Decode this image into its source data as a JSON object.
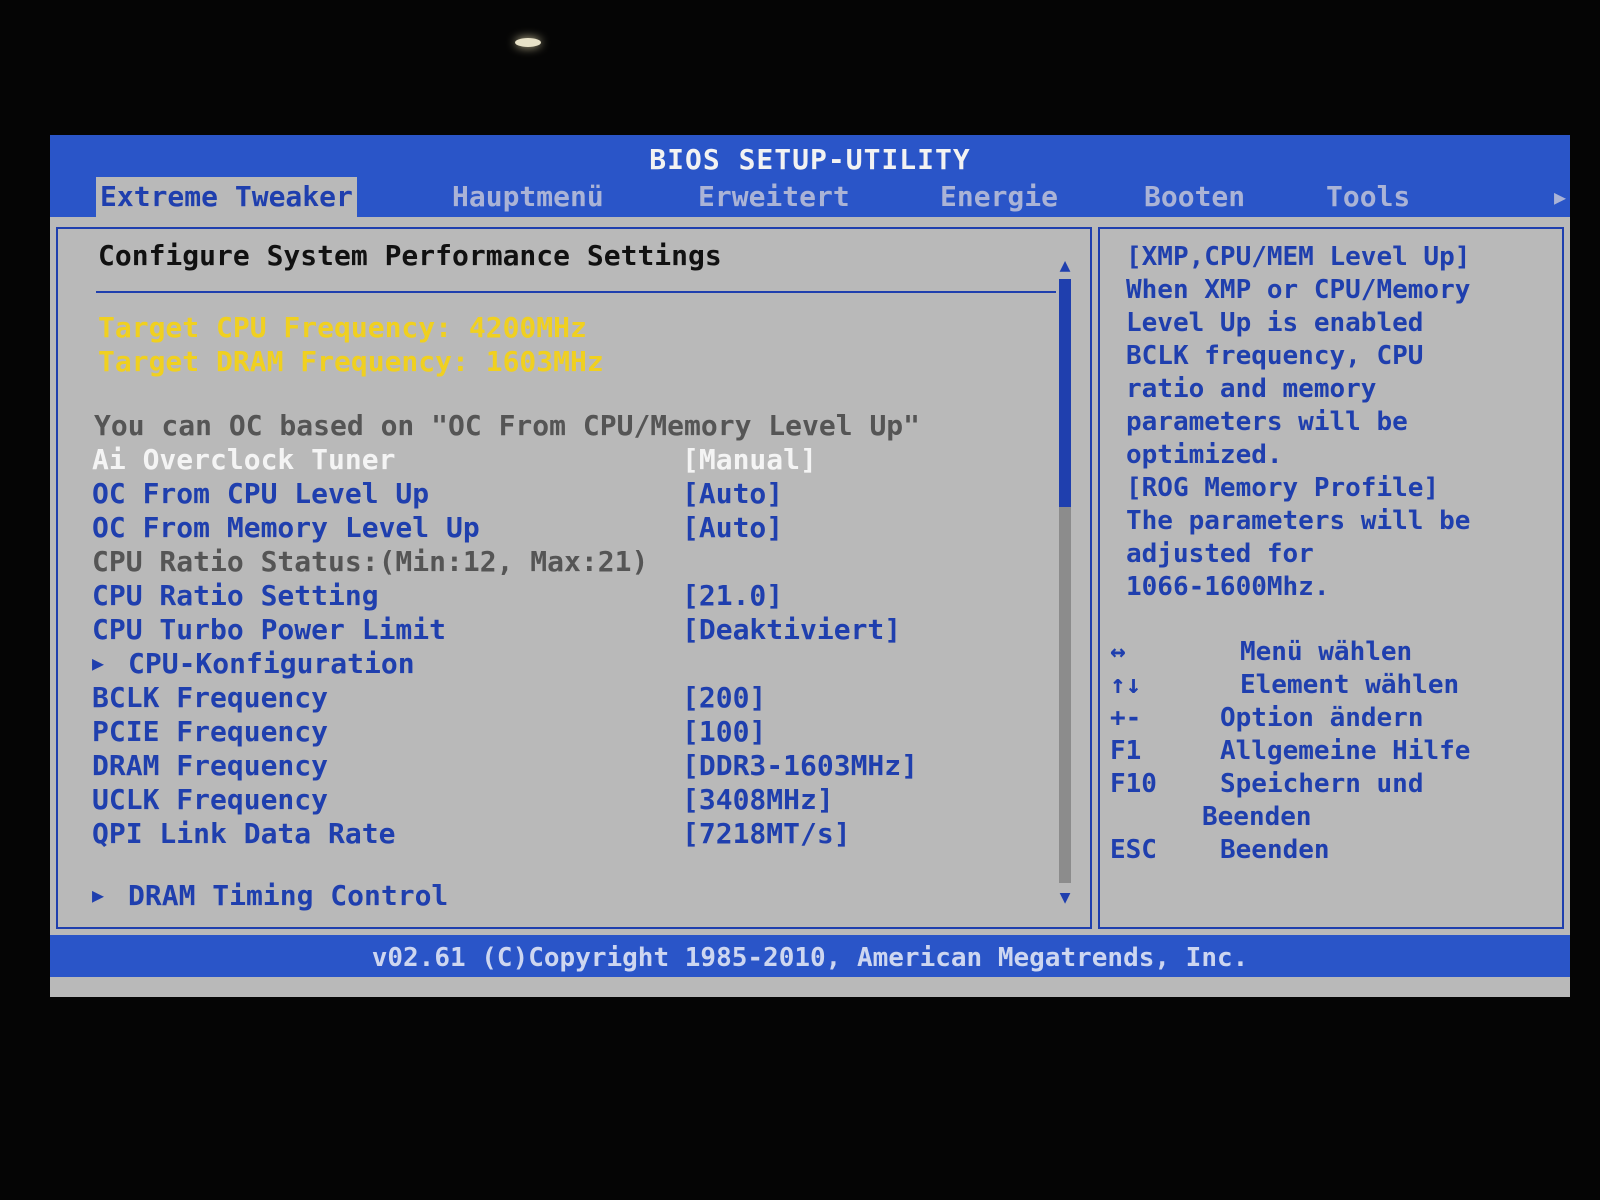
{
  "app": {
    "title": "BIOS SETUP-UTILITY"
  },
  "tabs": [
    {
      "label": "Extreme Tweaker",
      "active": true
    },
    {
      "label": "Hauptmenü",
      "active": false
    },
    {
      "label": "Erweitert",
      "active": false
    },
    {
      "label": "Energie",
      "active": false
    },
    {
      "label": "Booten",
      "active": false
    },
    {
      "label": "Tools",
      "active": false
    }
  ],
  "main": {
    "section_title": "Configure System Performance Settings",
    "target_cpu": "Target CPU Frequency: 4200MHz",
    "target_dram": "Target DRAM Frequency: 1603MHz",
    "oc_note": "You can OC based on \"OC From CPU/Memory Level Up\"",
    "settings": [
      {
        "label": "Ai Overclock Tuner",
        "value": "[Manual]"
      },
      {
        "label": "OC From CPU Level Up",
        "value": "[Auto]"
      },
      {
        "label": "OC From Memory Level Up",
        "value": "[Auto]"
      },
      {
        "label": "CPU Ratio Status:(Min:12, Max:21)",
        "value": ""
      },
      {
        "label": "CPU Ratio Setting",
        "value": "[21.0]"
      },
      {
        "label": "CPU Turbo Power Limit",
        "value": "[Deaktiviert]"
      },
      {
        "label": "CPU-Konfiguration",
        "value": ""
      },
      {
        "label": "BCLK Frequency",
        "value": "[200]"
      },
      {
        "label": "PCIE Frequency",
        "value": "[100]"
      },
      {
        "label": "DRAM Frequency",
        "value": "[DDR3-1603MHz]"
      },
      {
        "label": "UCLK Frequency",
        "value": "[3408MHz]"
      },
      {
        "label": "QPI Link Data Rate",
        "value": "[7218MT/s]"
      },
      {
        "label": "DRAM Timing Control",
        "value": ""
      }
    ]
  },
  "help": {
    "text": "[XMP,CPU/MEM Level Up]\nWhen XMP or CPU/Memory\nLevel Up is enabled\nBCLK frequency, CPU\nratio and memory\nparameters will be\noptimized.\n[ROG Memory Profile]\nThe parameters will be\nadjusted for\n1066-1600Mhz.",
    "keys": [
      {
        "key": "↔",
        "desc": "Menü wählen"
      },
      {
        "key": "↑↓",
        "desc": "Element wählen"
      },
      {
        "key": "+-",
        "desc": "Option ändern"
      },
      {
        "key": "F1",
        "desc": "Allgemeine Hilfe"
      },
      {
        "key": "F10",
        "desc": "Speichern und"
      },
      {
        "key": "",
        "desc": "Beenden"
      },
      {
        "key": "ESC",
        "desc": "Beenden"
      }
    ]
  },
  "footer": {
    "copyright": "v02.61 (C)Copyright 1985-2010, American Megatrends, Inc."
  },
  "colors": {
    "bios_blue": "#2a55c8",
    "text_blue": "#1f3fae",
    "panel_gray": "#b9b9b9",
    "highlight_yellow": "#f0d020"
  }
}
